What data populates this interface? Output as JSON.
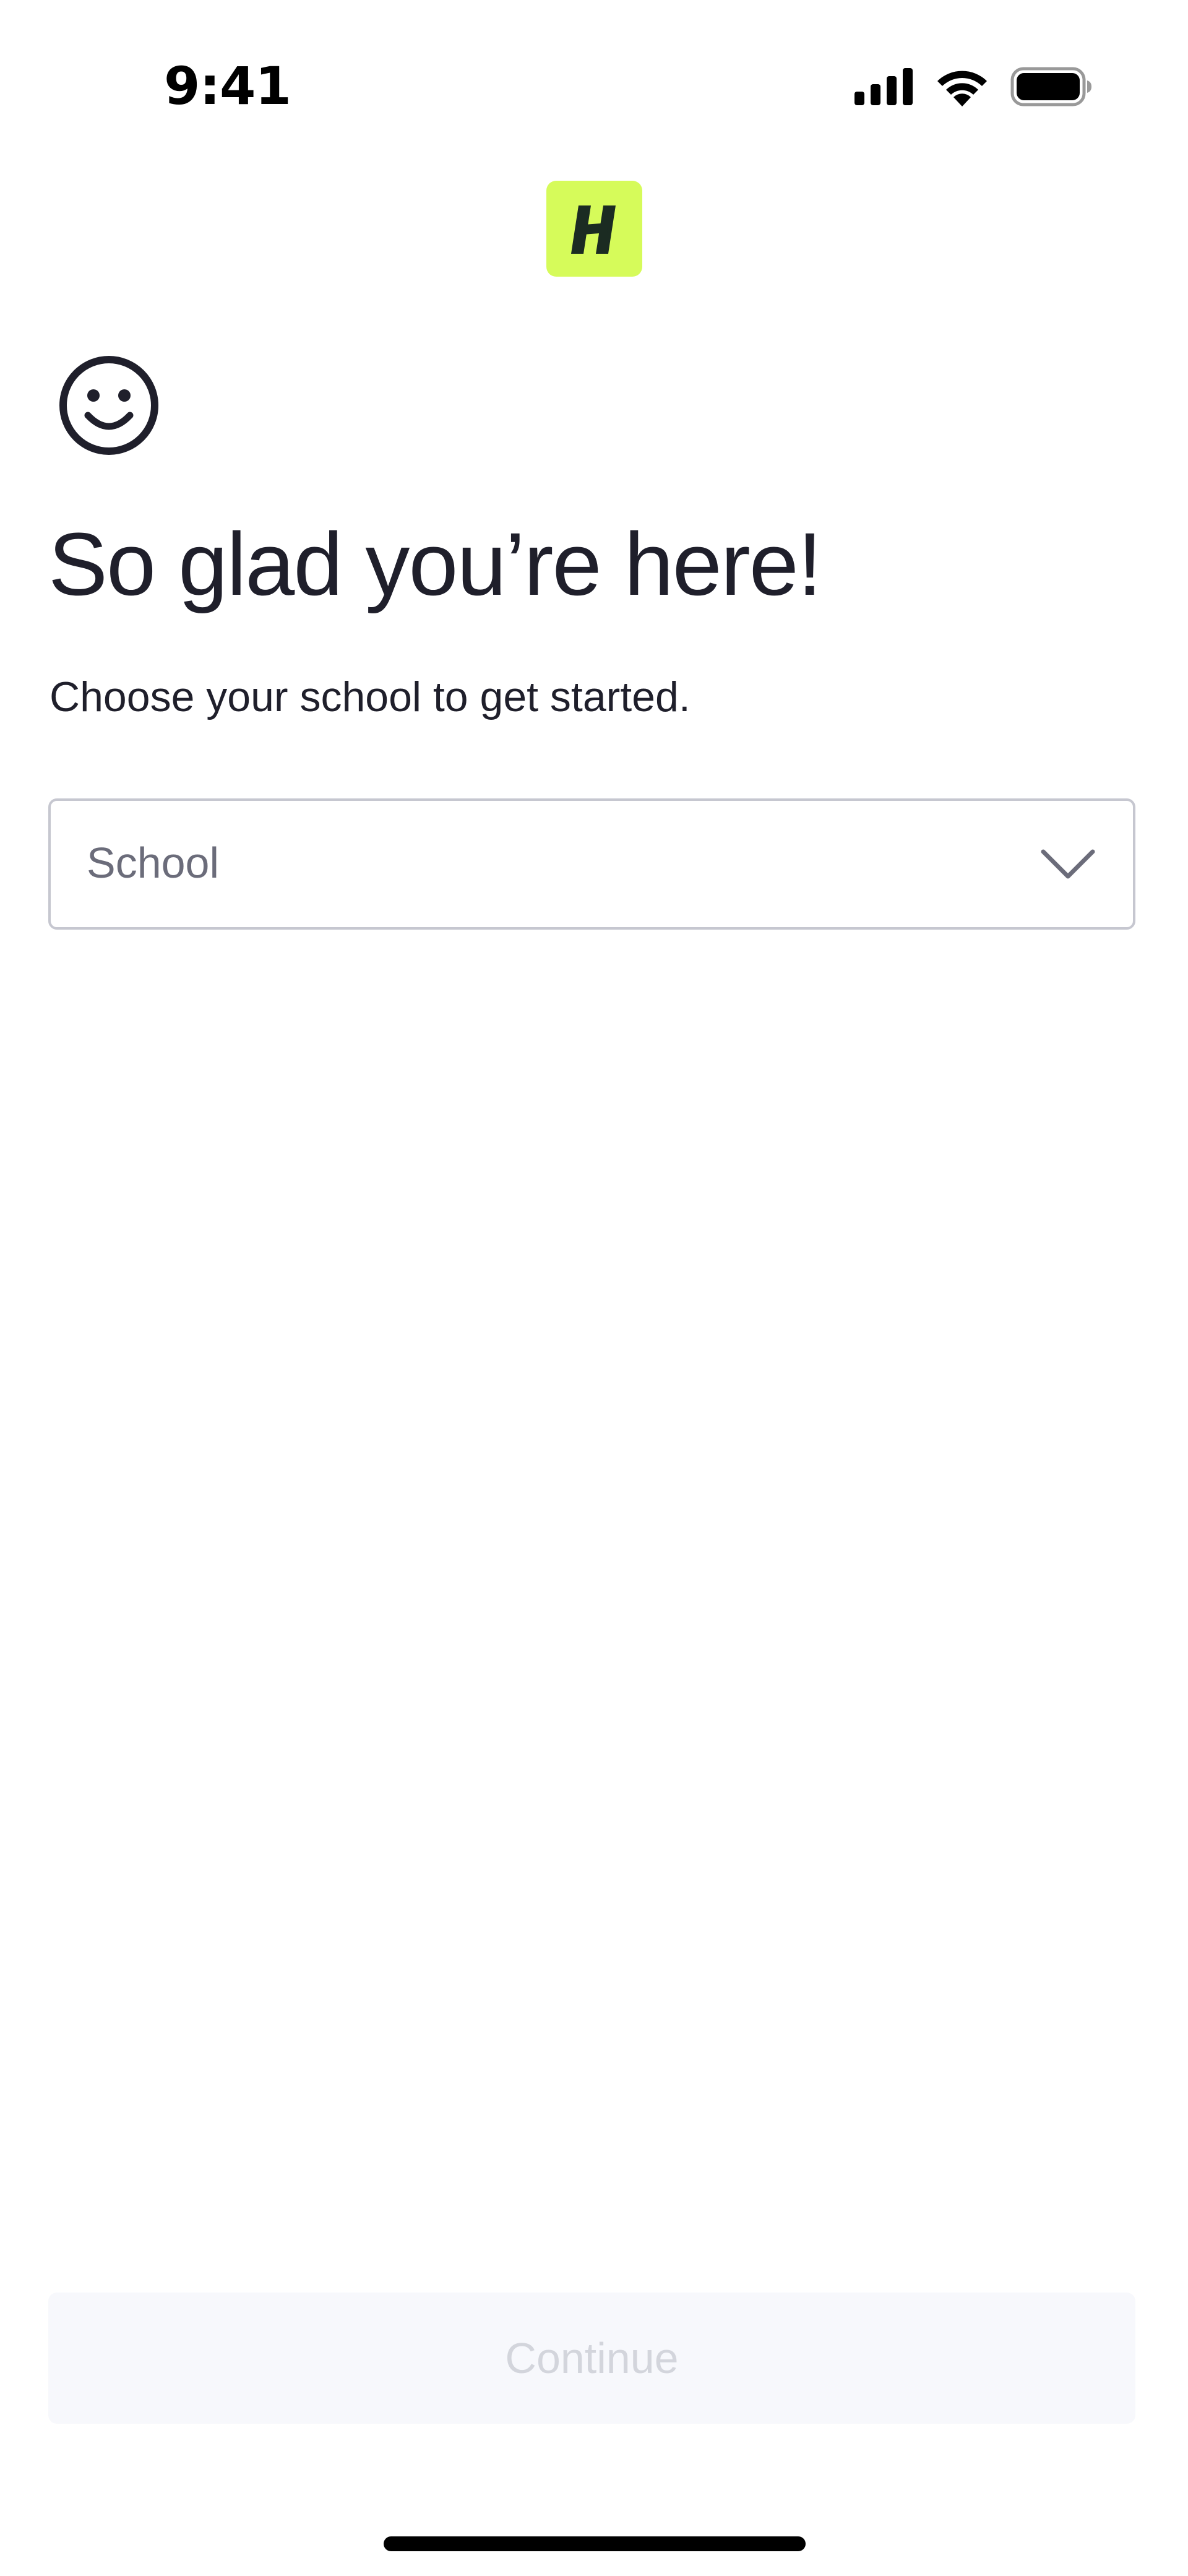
{
  "status_bar": {
    "time": "9:41",
    "icons": [
      "cellular-signal-icon",
      "wifi-icon",
      "battery-icon"
    ]
  },
  "logo": {
    "icon": "brand-logo-icon",
    "letter": "H",
    "background_color": "#d6fb5a",
    "letter_color": "#1b2b22"
  },
  "header_icon": "smiley-face-icon",
  "title": "So glad you’re here!",
  "subtitle": "Choose your school to get started.",
  "school_select": {
    "placeholder": "School",
    "icon": "chevron-down-icon"
  },
  "continue_button": {
    "label": "Continue",
    "state": "disabled"
  },
  "colors": {
    "text": "#1f1f2b",
    "placeholder": "#6b6c7a",
    "border": "#c6c7d0",
    "button_bg_disabled": "#f7f8fc",
    "button_text_disabled": "#d3d5dc"
  }
}
